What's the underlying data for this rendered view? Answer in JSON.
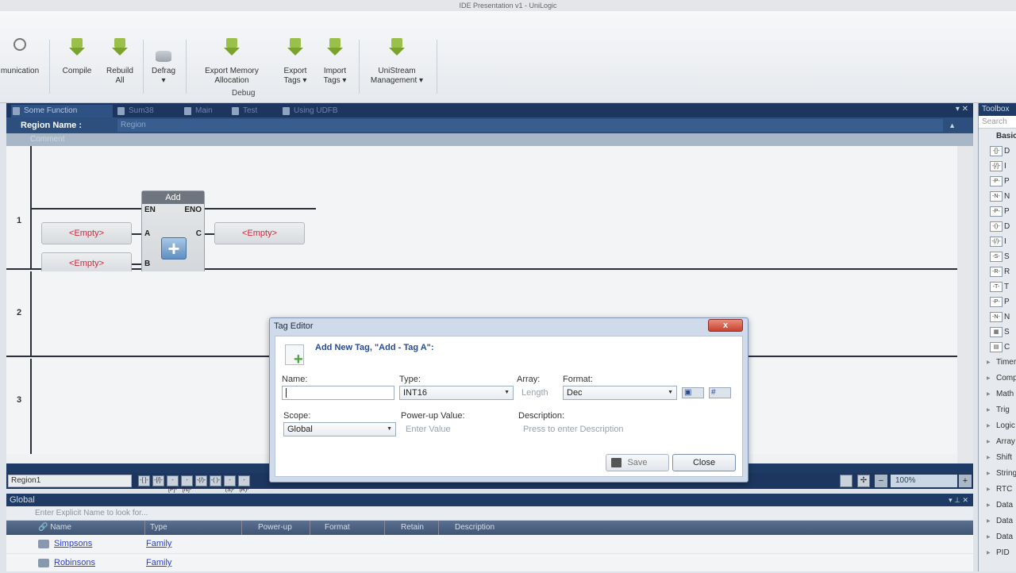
{
  "window": {
    "title": "IDE Presentation v1 - UniLogic"
  },
  "ribbon": {
    "buttons": [
      {
        "label": "munication",
        "icon": "communication-icon"
      },
      {
        "label": "Compile",
        "icon": "compile-icon"
      },
      {
        "label": "Rebuild All",
        "icon": "rebuild-icon"
      },
      {
        "label": "Defrag ▾",
        "icon": "defrag-icon"
      },
      {
        "label": "Export Memory Allocation",
        "icon": "export-memory-icon"
      },
      {
        "label": "Export Tags ▾",
        "icon": "export-tags-icon"
      },
      {
        "label": "Import Tags ▾",
        "icon": "import-tags-icon"
      },
      {
        "label": "UniStream Management ▾",
        "icon": "unistream-icon"
      }
    ],
    "group_label": "Debug"
  },
  "editor": {
    "tabs": [
      "Some Function",
      "Sum38",
      "Main",
      "Test",
      "Using UDFB"
    ],
    "region_label": "Region Name :",
    "region_value": "Region",
    "comment_label": "Comment",
    "rungs": [
      "1",
      "2",
      "3"
    ],
    "function_block": {
      "title": "Add",
      "en": "EN",
      "eno": "ENO",
      "pin_a": "A",
      "pin_b": "B",
      "pin_c": "C"
    },
    "empty_label": "<Empty>",
    "region_select": "Region1",
    "zoom": "100%",
    "toolbar_icons": [
      "-[ ]-",
      "-[/]-",
      "-[P]-",
      "-[N]-",
      "-(/)-",
      "-( )-",
      "-(S)-",
      "-(R)-"
    ]
  },
  "global_panel": {
    "title": "Global",
    "search_placeholder": "Enter Explicit Name to look for...",
    "columns": [
      "Name",
      "Type",
      "Power-up",
      "Format",
      "Retain",
      "Description"
    ],
    "rows": [
      {
        "name": "Simpsons",
        "type": "Family"
      },
      {
        "name": "Robinsons",
        "type": "Family"
      }
    ]
  },
  "toolbox": {
    "title": "Toolbox",
    "search_placeholder": "Search",
    "category": "Basic",
    "items": [
      "D",
      "I",
      "P",
      "N",
      "P",
      "D",
      "I",
      "S",
      "R",
      "T",
      "P",
      "N",
      "S",
      "C"
    ],
    "collapsed": [
      "Timers",
      "Compare",
      "Math",
      "Trig",
      "Logic",
      "Array",
      "Shift",
      "String",
      "RTC",
      "Data",
      "Data",
      "Data",
      "PID"
    ]
  },
  "dialog": {
    "title": "Tag Editor",
    "heading": "Add New Tag, \"Add - Tag A\":",
    "name_label": "Name:",
    "name_value": "",
    "type_label": "Type:",
    "type_value": "INT16",
    "array_label": "Array:",
    "array_placeholder": "Length",
    "format_label": "Format:",
    "format_value": "Dec",
    "scope_label": "Scope:",
    "scope_value": "Global",
    "powerup_label": "Power-up Value:",
    "powerup_placeholder": "Enter Value",
    "description_label": "Description:",
    "description_placeholder": "Press to enter Description",
    "save_label": "Save",
    "close_label": "Close",
    "close_x": "x"
  }
}
